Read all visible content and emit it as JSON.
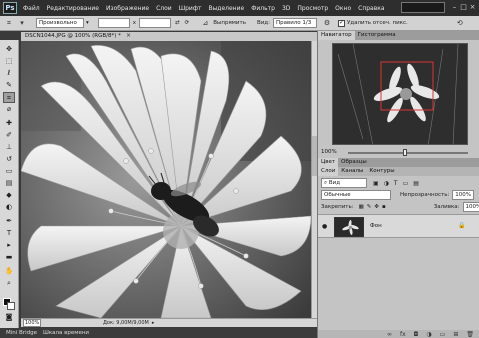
{
  "app": {
    "logo": "Ps"
  },
  "menu": [
    "Файл",
    "Редактирование",
    "Изображение",
    "Слои",
    "Шрифт",
    "Выделение",
    "Фильтр",
    "3D",
    "Просмотр",
    "Окно",
    "Справка"
  ],
  "options": {
    "style_value": "Произвольно",
    "x_sep": "x",
    "straighten_label": "Выпрямить",
    "view_label": "Вид:",
    "view_value": "Правило 1/3",
    "delete_cropped_label": "Удалить отсеч. пикс."
  },
  "document": {
    "tab_label": "DSCN1044.JPG @ 100% (RGB/8*) *",
    "close": "×",
    "zoom": "100%",
    "info": "Док: 9,00M/9,00M"
  },
  "bottom_tabs": [
    "Mini Bridge",
    "Шкала времени"
  ],
  "navigator": {
    "tabs": [
      "Навигатор",
      "Гистограмма"
    ],
    "zoom": "100%"
  },
  "color_tabs": [
    "Цвет",
    "Образцы"
  ],
  "layers": {
    "tabs": [
      "Слои",
      "Каналы",
      "Контуры"
    ],
    "kind_label": "Вид",
    "blend_mode": "Обычные",
    "opacity_label": "Непрозрачность:",
    "opacity_value": "100%",
    "lock_label": "Закрепить:",
    "fill_label": "Заливка:",
    "fill_value": "100%",
    "layer_name": "Фон"
  },
  "icons": {
    "crop_tool": "⌗",
    "gear": "⚙",
    "undo": "⟲",
    "eye": "●",
    "lock": "🔒"
  }
}
